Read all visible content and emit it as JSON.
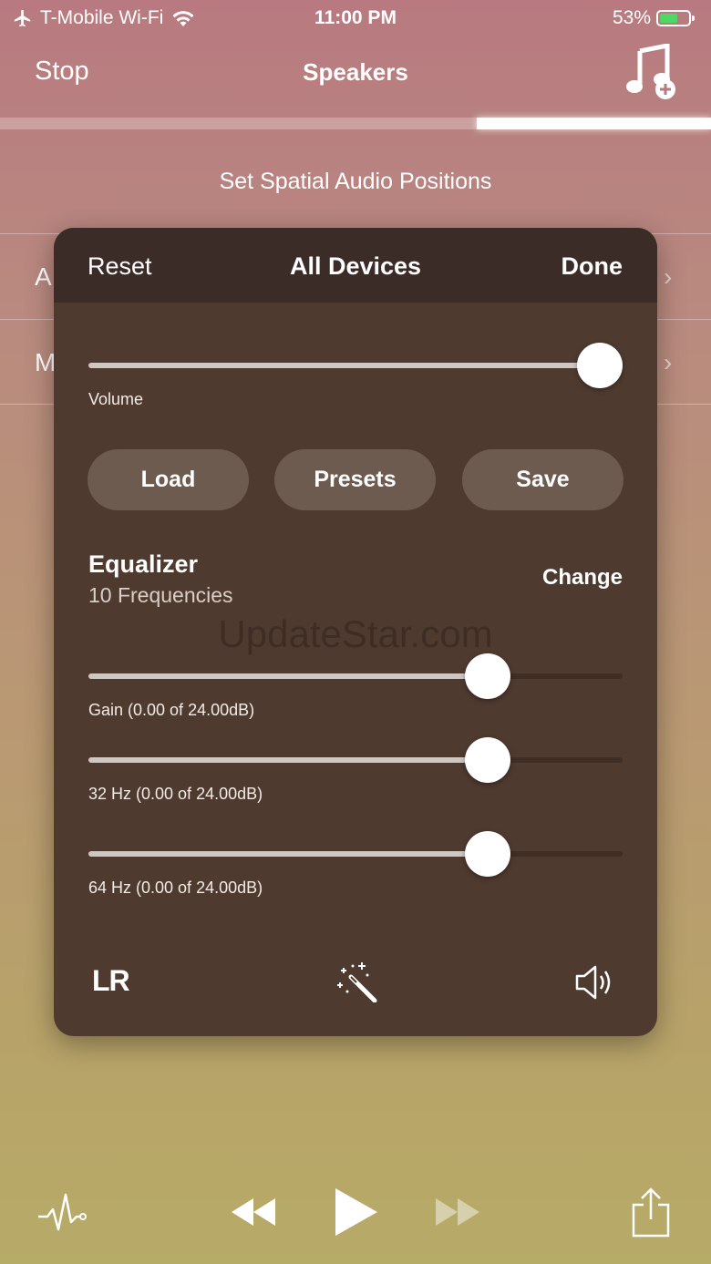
{
  "status": {
    "carrier": "T-Mobile Wi-Fi",
    "time": "11:00 PM",
    "battery": "53%"
  },
  "nav": {
    "back_label": "Stop",
    "title": "Speakers",
    "add_music_icon": "music-note-plus-icon",
    "playback_progress": 0.33
  },
  "list": {
    "header": "Set Spatial Audio Positions",
    "rows": [
      {
        "letter": "A"
      },
      {
        "letter": "M"
      }
    ]
  },
  "panel": {
    "reset_label": "Reset",
    "title": "All Devices",
    "done_label": "Done",
    "volume": {
      "label": "Volume",
      "value": 1.0
    },
    "buttons": {
      "load": "Load",
      "presets": "Presets",
      "save": "Save"
    },
    "equalizer": {
      "title": "Equalizer",
      "subtitle": "10 Frequencies",
      "change_label": "Change",
      "sliders": [
        {
          "label": "Gain (0.00 of 24.00dB)",
          "value": 0.77
        },
        {
          "label": "32 Hz (0.00 of 24.00dB)",
          "value": 0.77
        },
        {
          "label": "64 Hz (0.00 of 24.00dB)",
          "value": 0.77
        }
      ]
    },
    "watermark": "UpdateStar.com",
    "footer": {
      "lr_label": "LR",
      "wand_icon": "magic-wand-icon",
      "speaker_icon": "speaker-icon"
    }
  },
  "toolbar": {
    "icons": [
      "pulse-icon",
      "rewind-icon",
      "play-icon",
      "fast-forward-icon",
      "share-icon"
    ]
  },
  "colors": {
    "panel": "#4f3a2f",
    "panel_header": "#3b2c27",
    "button": "#6e5b50",
    "battery_green": "#4cd964"
  }
}
